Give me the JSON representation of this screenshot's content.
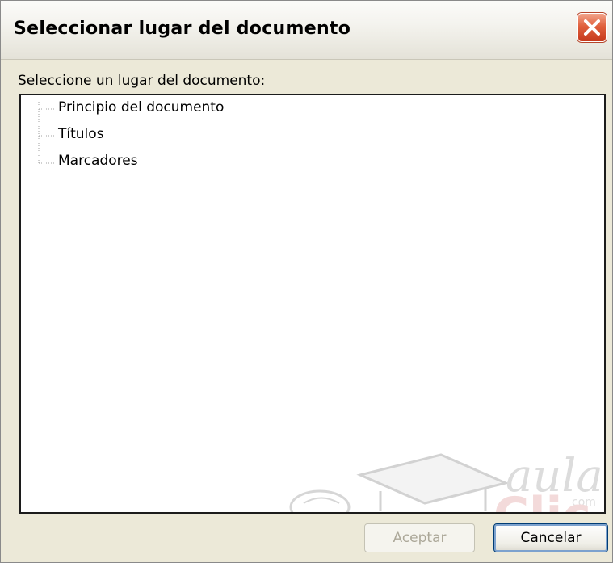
{
  "window": {
    "title": "Seleccionar lugar del documento",
    "close_icon": "close-icon"
  },
  "prompt": {
    "accesskey": "S",
    "rest": "eleccione un lugar del documento:"
  },
  "tree": {
    "items": [
      {
        "label": "Principio del documento"
      },
      {
        "label": "Títulos"
      },
      {
        "label": "Marcadores"
      }
    ]
  },
  "buttons": {
    "ok_label": "Aceptar",
    "ok_enabled": false,
    "cancel_label": "Cancelar"
  },
  "watermark": {
    "word_top": "aula",
    "word_bottom": "Clic",
    "suffix": "com"
  },
  "colors": {
    "dialog_bg": "#ece9d8",
    "close_button": "#e0603d",
    "disabled_text": "#aca899"
  }
}
